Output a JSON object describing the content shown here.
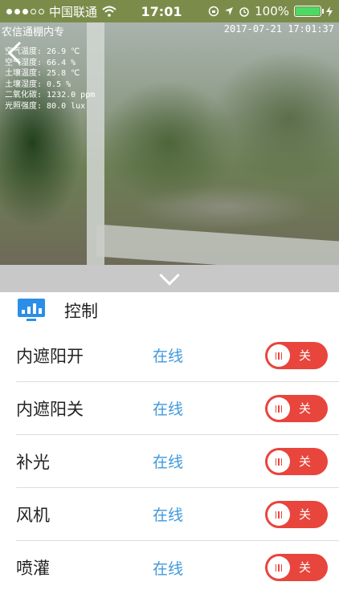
{
  "status_bar": {
    "carrier": "中国联通",
    "time": "17:01",
    "battery": "100%",
    "battery_level": 1.0,
    "icons": [
      "signal-dots-icon",
      "wifi-icon",
      "rotation-lock-icon",
      "location-icon",
      "alarm-icon",
      "battery-icon",
      "charging-icon"
    ]
  },
  "camera": {
    "title": "农信通棚内专",
    "timestamp": "2017-07-21 17:01:37",
    "sensors": [
      {
        "label": "空气温度:",
        "value": "26.9 ℃"
      },
      {
        "label": "空气湿度:",
        "value": "66.4 %"
      },
      {
        "label": "土壤温度:",
        "value": "25.8 ℃"
      },
      {
        "label": "土壤湿度:",
        "value": "0.5 %"
      },
      {
        "label": "二氧化碳:",
        "value": "1232.0 ppm"
      },
      {
        "label": "光照强度:",
        "value": "80.0 lux"
      }
    ]
  },
  "control": {
    "title": "控制",
    "devices": [
      {
        "name": "内遮阳开",
        "status": "在线",
        "switch_label": "关"
      },
      {
        "name": "内遮阳关",
        "status": "在线",
        "switch_label": "关"
      },
      {
        "name": "补光",
        "status": "在线",
        "switch_label": "关"
      },
      {
        "name": "风机",
        "status": "在线",
        "switch_label": "关"
      },
      {
        "name": "喷灌",
        "status": "在线",
        "switch_label": "关"
      }
    ]
  },
  "colors": {
    "accent_blue": "#2b8fe8",
    "status_blue": "#3f99dd",
    "toggle_red": "#e8453c",
    "battery_green": "#4cd964"
  }
}
